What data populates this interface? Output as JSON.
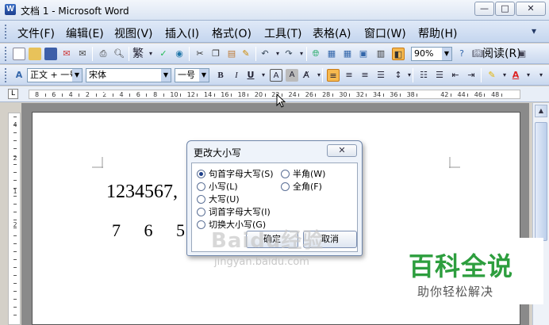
{
  "window": {
    "title": "文档 1 - Microsoft Word",
    "min": "—",
    "max": "□",
    "close": "✕"
  },
  "menu": {
    "items": [
      "文件(F)",
      "编辑(E)",
      "视图(V)",
      "插入(I)",
      "格式(O)",
      "工具(T)",
      "表格(A)",
      "窗口(W)",
      "帮助(H)"
    ],
    "extra": "▾"
  },
  "toolbar1": {
    "simplified": "繁",
    "zoom": "90%",
    "read": "阅读(R)"
  },
  "toolbar2": {
    "style": "正文 + 一号",
    "font": "宋体",
    "size": "一号"
  },
  "ruler": {
    "corner": "L",
    "numbers": [
      "8",
      "6",
      "4",
      "2",
      "2",
      "4",
      "6",
      "8",
      "10",
      "12",
      "14",
      "16",
      "18",
      "20",
      "22",
      "24",
      "26",
      "28",
      "30",
      "32",
      "34",
      "36",
      "38",
      "42",
      "44",
      "46",
      "48"
    ],
    "vnumbers": [
      "4",
      "2",
      "1",
      "2"
    ]
  },
  "document": {
    "line1": "1234567,",
    "line2": "7 6 5 4"
  },
  "dialog": {
    "title": "更改大小写",
    "close": "✕",
    "options_left": [
      {
        "label": "句首字母大写(S)",
        "selected": true
      },
      {
        "label": "小写(L)",
        "selected": false
      },
      {
        "label": "大写(U)",
        "selected": false
      },
      {
        "label": "词首字母大写(I)",
        "selected": false
      },
      {
        "label": "切换大小写(G)",
        "selected": false
      }
    ],
    "options_right": [
      {
        "label": "半角(W)",
        "selected": false
      },
      {
        "label": "全角(F)",
        "selected": false
      }
    ],
    "ok": "确定",
    "cancel": "取消"
  },
  "watermark": {
    "brand": "Baidu经验",
    "url": "jingyan.baidu.com"
  },
  "badge": {
    "title": "百科全说",
    "subtitle": "助你轻松解决",
    "color": "#2d9e3e"
  }
}
